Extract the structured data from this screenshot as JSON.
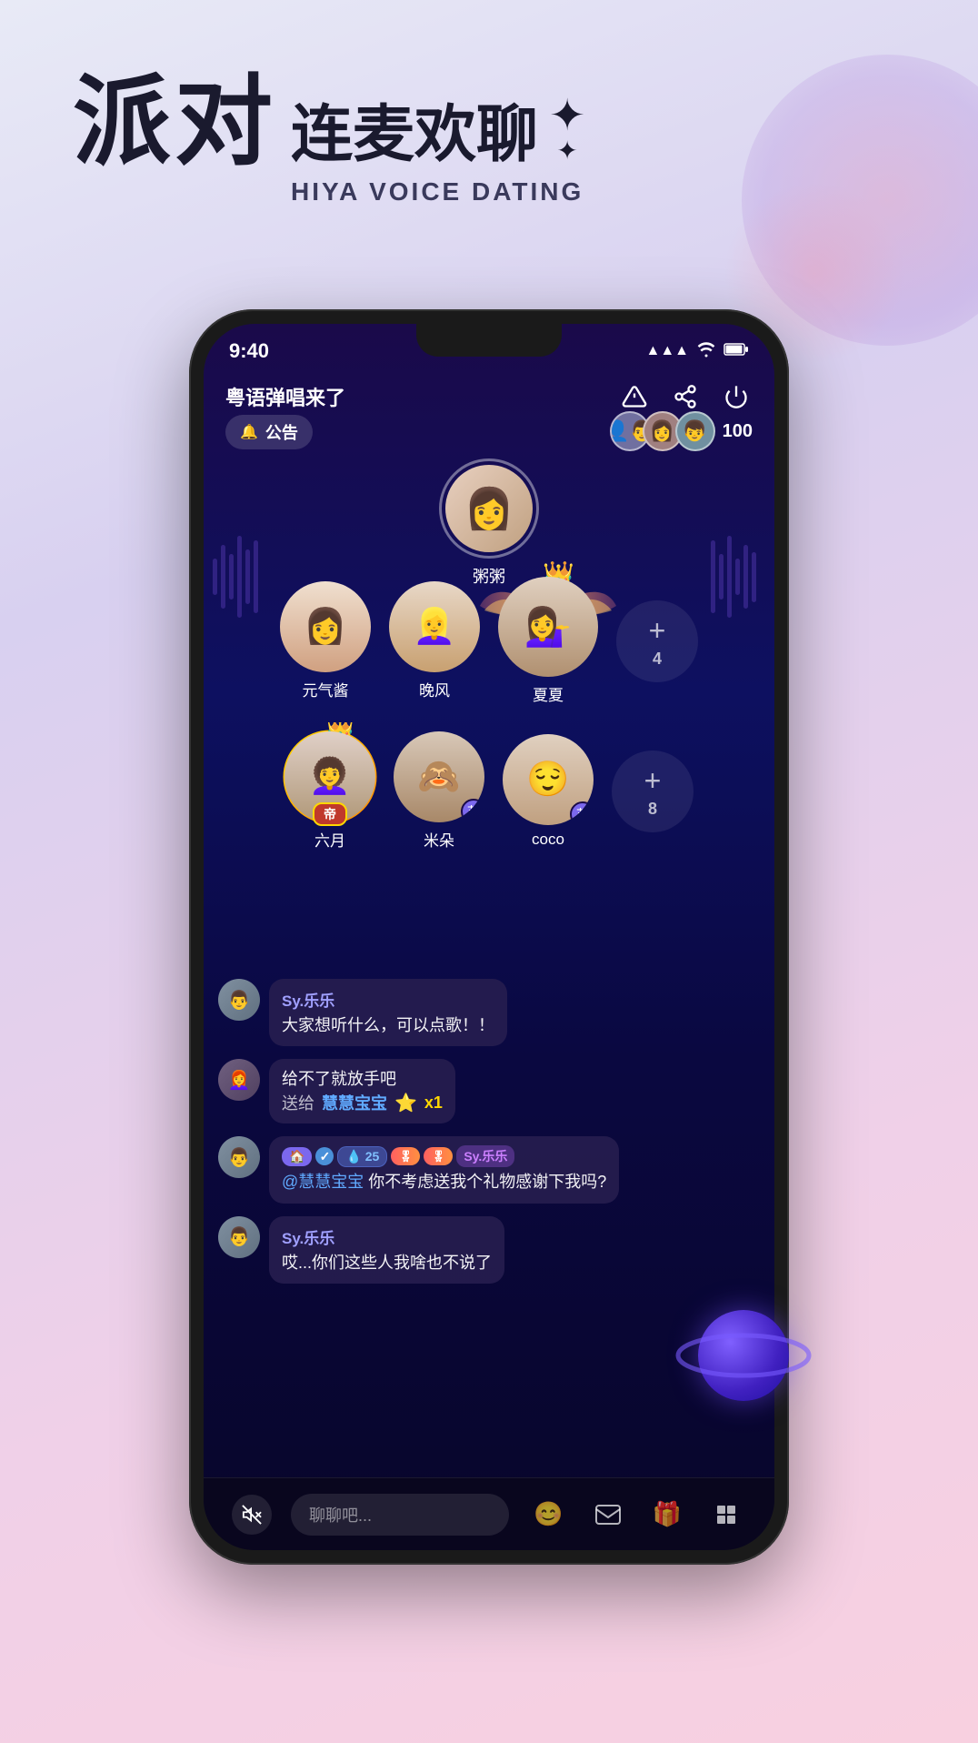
{
  "app": {
    "title": "Hiya Voice Dating",
    "tagline_cn_main": "派对",
    "tagline_cn_sub": "连麦欢聊",
    "tagline_en": "HIYA VOICE DATING",
    "sparkle": "✦"
  },
  "status_bar": {
    "time": "9:40",
    "signal": "▲▲▲",
    "wifi": "wifi",
    "battery": "battery"
  },
  "room": {
    "title": "粤语弹唱来了",
    "announcement_label": "公告",
    "audience_count": "100",
    "host_name": "粥粥",
    "seats_row1": [
      {
        "name": "元气酱",
        "type": "normal"
      },
      {
        "name": "晚风",
        "type": "normal"
      },
      {
        "name": "夏夏",
        "type": "featured"
      },
      {
        "type": "plus",
        "count": "4"
      }
    ],
    "seats_row2": [
      {
        "name": "六月",
        "type": "crowned"
      },
      {
        "name": "米朵",
        "type": "normal_badge"
      },
      {
        "name": "coco",
        "type": "normal_badge"
      },
      {
        "type": "plus",
        "count": "8"
      }
    ]
  },
  "chat": {
    "messages": [
      {
        "id": 1,
        "username": "Sy.乐乐",
        "text": "大家想听什么，可以点歌！！",
        "type": "normal"
      },
      {
        "id": 2,
        "username": "",
        "text": "给不了就放手吧",
        "gift_to": "慧慧宝宝",
        "gift_label": "送给",
        "gift_count": "x1",
        "type": "gift"
      },
      {
        "id": 3,
        "username": "Sy.乐乐",
        "text": "@慧慧宝宝 你不考虑送我个礼物感谢下我吗?",
        "type": "badge",
        "badges": [
          "🏠",
          "✓",
          "25",
          "🎖",
          "🎖",
          "Sy.乐乐"
        ]
      },
      {
        "id": 4,
        "username": "Sy.乐乐",
        "text": "哎...你们这些人我啥也不说了",
        "type": "normal"
      }
    ],
    "input_placeholder": "聊聊吧..."
  },
  "bottom_bar": {
    "mute_label": "🔇",
    "chat_placeholder": "聊聊吧...",
    "emoji_icon": "😊",
    "mail_icon": "✉",
    "gift_icon": "🎁",
    "grid_icon": "⊞"
  }
}
